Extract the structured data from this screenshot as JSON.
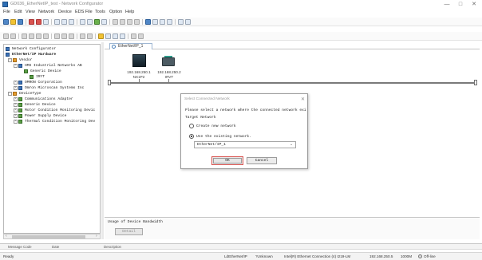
{
  "window": {
    "title": "GD036_EtherNetIP_test - Network Configurator",
    "controls": {
      "minimize": "—",
      "maximize": "□",
      "close": "✕"
    }
  },
  "menu": [
    "File",
    "Edit",
    "View",
    "Network",
    "Device",
    "EDS File",
    "Tools",
    "Option",
    "Help"
  ],
  "tree": {
    "root": "Network Configurator",
    "hardware": "EtherNet/IP Hardware",
    "items": [
      {
        "label": "Vendor",
        "level": 1,
        "icon": "folder-icon"
      },
      {
        "label": "HMS Industrial Networks AB",
        "level": 2,
        "icon": "vendor-icon"
      },
      {
        "label": "Generic Device",
        "level": 3,
        "icon": "device-icon"
      },
      {
        "label": "IRYT",
        "level": 4,
        "icon": "device-icon"
      },
      {
        "label": "OMRON Corporation",
        "level": 2,
        "icon": "vendor-icon"
      },
      {
        "label": "Omron Microscan Systems Inc",
        "level": 2,
        "icon": "vendor-icon"
      },
      {
        "label": "DeviceType",
        "level": 1,
        "icon": "folder-icon"
      },
      {
        "label": "Communications Adapter",
        "level": 2,
        "icon": "device-icon"
      },
      {
        "label": "Generic Device",
        "level": 2,
        "icon": "device-icon"
      },
      {
        "label": "Motor Condition Monitoring Devic",
        "level": 2,
        "icon": "device-icon"
      },
      {
        "label": "Power Supply Device",
        "level": 2,
        "icon": "device-icon"
      },
      {
        "label": "Thermal Condition Monitoring Dev",
        "level": 2,
        "icon": "device-icon"
      }
    ]
  },
  "network_tab": {
    "label": "EtherNet/IP_1"
  },
  "devices": [
    {
      "ip": "192.168.250.1",
      "name": "NX1P2"
    },
    {
      "ip": "192.168.250.2",
      "name": "IRVT"
    }
  ],
  "dialog": {
    "title": "Select Connected Network",
    "prompt": "Please select a network where the connected network exi",
    "target_label": "Target Network",
    "option_create": "Create new network",
    "option_use": "Use the existing network.",
    "selected_network": "EtherNet/IP_1",
    "ok": "OK",
    "cancel": "Cancel",
    "selected_option": "use"
  },
  "bandwidth": {
    "title": "Usage of Device Bandwidth",
    "detail_button": "Detail"
  },
  "grid_headers": [
    "Message Code",
    "Date",
    "Description"
  ],
  "status": {
    "left": "Ready",
    "network": "LdEtherNet/IP",
    "unknown": "?Unknown",
    "adapter": "Intel(R) Ethernet Connection (4) I219-LM",
    "ip": "192.168.250.5",
    "speed": "1000M",
    "mode": "Off-line"
  },
  "colors": {
    "ok_highlight": "#d9534f",
    "accent": "#2f6fb5"
  }
}
